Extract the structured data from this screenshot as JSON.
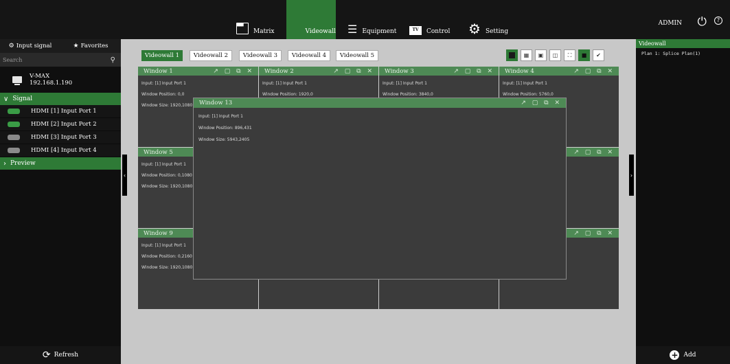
{
  "nav": {
    "items": [
      {
        "label": "Matrix",
        "icon": "matrix-icon"
      },
      {
        "label": "Videowall",
        "icon": "videowall-grid-icon",
        "active": true
      },
      {
        "label": "Equipment",
        "icon": "equipment-stack-icon"
      },
      {
        "label": "Control",
        "icon": "control-tv-icon"
      },
      {
        "label": "Setting",
        "icon": "gear-icon"
      }
    ],
    "user": "ADMIN",
    "power_icon": "power-icon",
    "help_icon": "help-icon",
    "accent_color": "#2e7a36"
  },
  "sidebar": {
    "tabs": [
      {
        "label": "Input signal",
        "icon": "input-signal-icon"
      },
      {
        "label": "Favorites",
        "icon": "star-icon"
      }
    ],
    "search_placeholder": "Search",
    "device": {
      "name": "V-MAX",
      "ip": "192.168.1.190"
    },
    "signal_section": "Signal",
    "ports": [
      {
        "label": "HDMI [1] Input Port 1",
        "color": "#3a9c46"
      },
      {
        "label": "HDMI [2] Input Port 2",
        "color": "#3a9c46"
      },
      {
        "label": "HDMI [3] Input Port 3",
        "color": "#8a8a8a"
      },
      {
        "label": "HDMI [4] Input Port 4",
        "color": "#8a8a8a"
      }
    ],
    "preview_section": "Preview",
    "refresh_label": "Refresh"
  },
  "main": {
    "videowall_tabs": [
      "Videowall 1",
      "Videowall 2",
      "Videowall 3",
      "Videowall 4",
      "Videowall 5"
    ],
    "active_tab": 0,
    "toolbar_icons": [
      "layout-1x1-icon",
      "layout-2x2-icon",
      "picture-icon",
      "overlay-icon",
      "fullscreen-icon",
      "lock-icon",
      "clear-brush-icon"
    ],
    "windows": [
      {
        "title": "Window 1",
        "input": "Input: [1] Input Port 1",
        "position": "Window Position: 0,0",
        "size": "Window Size: 1920,1080"
      },
      {
        "title": "Window 2",
        "input": "Input: [1] Input Port 1",
        "position": "Window Position: 1920,0",
        "size": ""
      },
      {
        "title": "Window 3",
        "input": "Input: [1] Input Port 1",
        "position": "Window Position: 3840,0",
        "size": ""
      },
      {
        "title": "Window 4",
        "input": "Input: [1] Input Port 1",
        "position": "Window Position: 5760,0",
        "size": ""
      },
      {
        "title": "Window 5",
        "input": "Input: [1] Input Port 1",
        "position": "Window Position: 0,1080",
        "size": "Window Size: 1920,1080"
      },
      {
        "title": "Window 9",
        "input": "Input: [1] Input Port 1",
        "position": "Window Position: 0,2160",
        "size": "Window Size: 1920,1080"
      }
    ],
    "window13": {
      "title": "Window 13",
      "input": "Input: [1] Input Port 1",
      "position": "Window Position: 896,431",
      "size": "Window Size: 5943,2405"
    },
    "window_controls": "↗ ▢ ⧉ ✕"
  },
  "right_panel": {
    "header": "Videowall",
    "plans": [
      "Plan 1: Splice Plan(1)"
    ],
    "add_label": "Add"
  }
}
